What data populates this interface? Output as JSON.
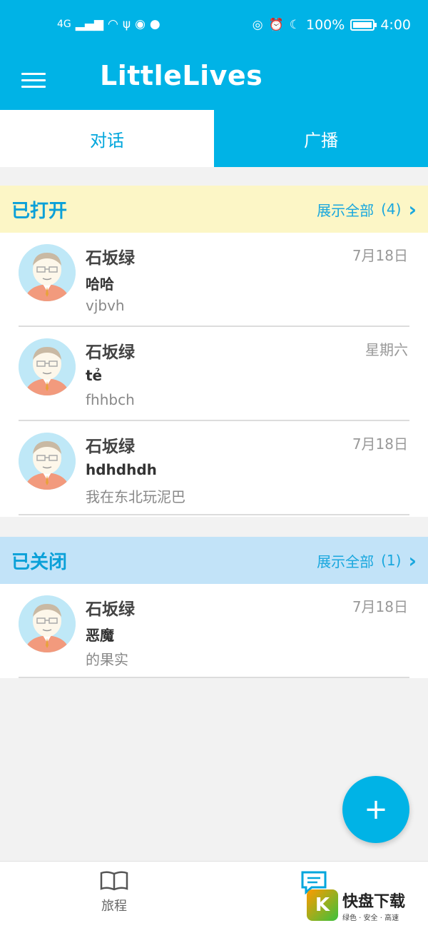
{
  "status_bar": {
    "network": "4G",
    "battery_percent": "100%",
    "time": "4:00"
  },
  "app": {
    "title": "LittleLives"
  },
  "tabs": [
    {
      "label": "对话",
      "active": true
    },
    {
      "label": "广播",
      "active": false
    }
  ],
  "sections": {
    "open": {
      "title": "已打开",
      "show_all": "展示全部",
      "count": "(4)",
      "items": [
        {
          "name": "石坂绿",
          "subject": "哈哈",
          "preview": "vjbvh",
          "date": "7月18日"
        },
        {
          "name": "石坂绿",
          "subject": "tẻ",
          "preview": "fhhbch",
          "date": "星期六"
        },
        {
          "name": "石坂绿",
          "subject": "hdhdhdh",
          "preview": "我在东北玩泥巴",
          "date": "7月18日"
        }
      ]
    },
    "closed": {
      "title": "已关闭",
      "show_all": "展示全部",
      "count": "(1)",
      "items": [
        {
          "name": "石坂绿",
          "subject": "恶魔",
          "preview": "的果实",
          "date": "7月18日"
        }
      ]
    }
  },
  "fab": {
    "icon": "plus-icon",
    "label": "+"
  },
  "bottom_nav": [
    {
      "label": "旅程",
      "icon": "book-icon"
    },
    {
      "label": "信",
      "icon": "message-icon",
      "active": true
    }
  ],
  "watermark": {
    "mark": "K",
    "title": "快盘下载",
    "subtitle": "绿色 · 安全 · 高速"
  },
  "colors": {
    "primary": "#00b3e6",
    "open_header": "#fcf6c6",
    "closed_header": "#c2e3f8",
    "accent_text": "#19a7de"
  }
}
